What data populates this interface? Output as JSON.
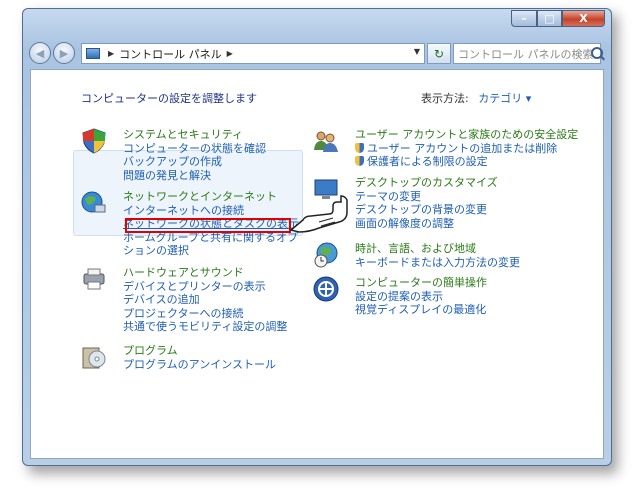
{
  "window": {
    "min_glyph": "–",
    "max_glyph": "□",
    "close_glyph": "X"
  },
  "nav": {
    "back_glyph": "◀",
    "forward_glyph": "▶",
    "address": "コントロール パネル",
    "address_sep": "▶",
    "search_placeholder": "コントロール パネルの検索",
    "refresh_glyph": "↻"
  },
  "main": {
    "title": "コンピューターの設定を調整します",
    "view_by_label": "表示方法:",
    "view_by_value": "カテゴリ ▾"
  },
  "categories": [
    {
      "head": "システムとセキュリティ",
      "links": [
        "コンピューターの状態を確認",
        "バックアップの作成",
        "問題の発見と解決"
      ]
    },
    {
      "head": "ネットワークとインターネット",
      "links": [
        "インターネットへの接続",
        "ネットワークの状態とタスクの表示",
        "ホームグループと共有に関するオプションの選択"
      ]
    },
    {
      "head": "ハードウェアとサウンド",
      "links": [
        "デバイスとプリンターの表示",
        "デバイスの追加",
        "プロジェクターへの接続",
        "共通で使うモビリティ設定の調整"
      ]
    },
    {
      "head": "プログラム",
      "links": [
        "プログラムのアンインストール"
      ]
    },
    {
      "head": "ユーザー アカウントと家族のための安全設定",
      "links": [
        "ユーザー アカウントの追加または削除",
        "保護者による制限の設定"
      ]
    },
    {
      "head": "デスクトップのカスタマイズ",
      "links": [
        "テーマの変更",
        "デスクトップの背景の変更",
        "画面の解像度の調整"
      ]
    },
    {
      "head": "時計、言語、および地域",
      "links": [
        "キーボードまたは入力方法の変更"
      ]
    },
    {
      "head": "コンピューターの簡単操作",
      "links": [
        "設定の提案の表示",
        "視覚ディスプレイの最適化"
      ]
    }
  ],
  "colors": {
    "category_head": "#2a7a16",
    "link": "#1e5fb4",
    "highlight": "#e00000"
  }
}
